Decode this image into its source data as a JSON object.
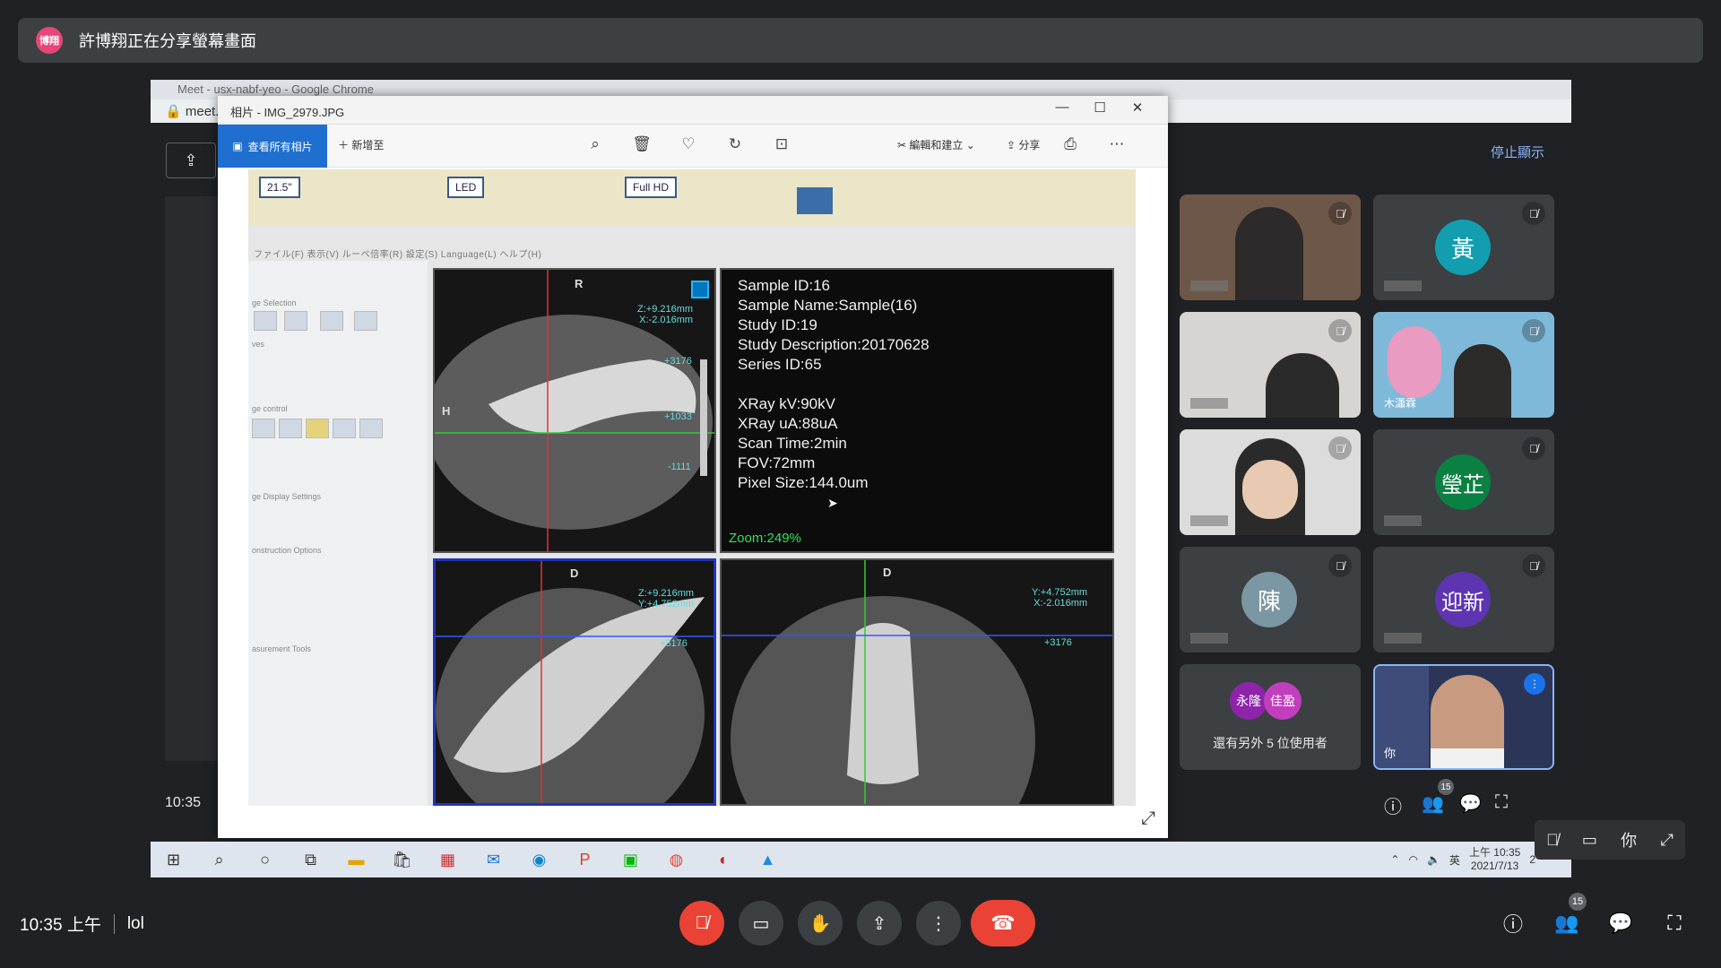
{
  "banner": {
    "avatar_text": "博翔",
    "text": "許博翔正在分享螢幕畫面"
  },
  "chrome": {
    "tab_title": "Meet - usx-nabf-yeo - Google Chrome",
    "address": "meet."
  },
  "meet_shared": {
    "stop_presenting": "停止顯示",
    "nested_time": "10:35"
  },
  "photos": {
    "title": "相片 - IMG_2979.JPG",
    "view_all": "查看所有相片",
    "add_to": "新增至",
    "edit_create": "編輯和建立",
    "share": "分享"
  },
  "monitor": {
    "logo_size": "21.5\"",
    "logo_led": "LED",
    "logo_fullhd": "Full HD"
  },
  "ct_app": {
    "menu": "ファイル(F)   表示(V)   ルーペ倍率(R)   設定(S)   Language(L)   ヘルプ(H)",
    "side_labels": [
      "ge Selection",
      "ves",
      "ge control",
      "ge Display Settings",
      "onstruction Options",
      "asurement Tools"
    ],
    "info_lines": [
      "Sample ID:16",
      "Sample Name:Sample(16)",
      "Study ID:19",
      "Study Description:20170628",
      "Series ID:65",
      "XRay kV:90kV",
      "XRay uA:88uA",
      "Scan Time:2min",
      "FOV:72mm",
      "Pixel Size:144.0um"
    ],
    "zoom": "Zoom:249%",
    "ct1": {
      "label_top": "R",
      "label_left": "H",
      "coords": "Z:+9.216mm\nX:-2.016mm",
      "v1": "+3176",
      "v2": "+1033",
      "v3": "-1111"
    },
    "ct2": {
      "label_top": "D",
      "coords": "Z:+9.216mm\nY:+4.752mm",
      "v1": "+3176"
    },
    "ct3": {
      "label_top": "D",
      "coords": "Y:+4.752mm\nX:-2.016mm",
      "v1": "+3176"
    }
  },
  "tiles": [
    {
      "type": "video",
      "muted": true
    },
    {
      "type": "avatar",
      "initial": "黃",
      "color": "#129eaf",
      "muted": true
    },
    {
      "type": "video",
      "muted": true
    },
    {
      "type": "video",
      "muted": true,
      "name": "木瀟霖"
    },
    {
      "type": "video",
      "muted": true
    },
    {
      "type": "avatar",
      "initial": "瑩芷",
      "color": "#0b8043",
      "muted": true
    },
    {
      "type": "avatar",
      "initial": "陳",
      "color": "#7b97a3",
      "muted": true
    },
    {
      "type": "avatar",
      "initial": "迎新",
      "color": "#5e35b1",
      "muted": true
    },
    {
      "type": "more",
      "avatars": [
        "永隆",
        "佳盈"
      ],
      "text": "還有另外 5 位使用者"
    },
    {
      "type": "self",
      "name": "你"
    }
  ],
  "taskbar": {
    "tray_ime": "英",
    "tray_time": "上午 10:35",
    "tray_date": "2021/7/13",
    "tray_notif": "2"
  },
  "mini_controls": {
    "self_label": "你"
  },
  "bottom": {
    "time": "10:35 上午",
    "meeting_name": "lol",
    "people_count": "15"
  },
  "shared_people_count": "15"
}
